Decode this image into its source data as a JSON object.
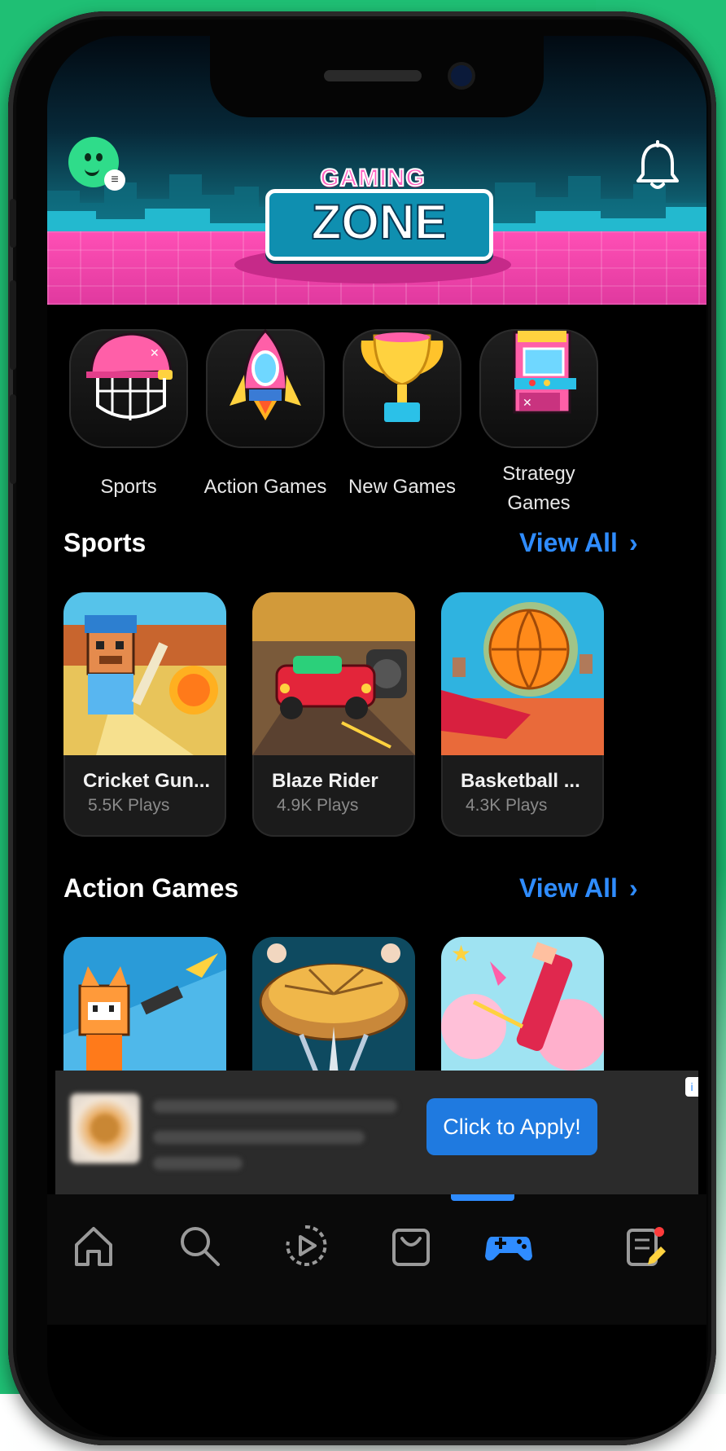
{
  "header": {
    "logo_top": "GAMING",
    "logo_main": "ZONE",
    "avatar_menu_icon": "menu-badge-icon",
    "notification_icon": "bell-icon"
  },
  "categories": [
    {
      "label": "Sports",
      "icon": "cricket-helmet-icon"
    },
    {
      "label": "Action Games",
      "icon": "rocket-icon"
    },
    {
      "label": "New Games",
      "icon": "trophy-icon"
    },
    {
      "label": "Strategy Games",
      "icon": "arcade-machine-icon"
    }
  ],
  "sports": {
    "title": "Sports",
    "view_all": "View All",
    "games": [
      {
        "name": "Cricket Gun...",
        "plays": "5.5K  Plays"
      },
      {
        "name": "Blaze Rider",
        "plays": "4.9K  Plays"
      },
      {
        "name": "Basketball ...",
        "plays": "4.3K  Plays"
      }
    ]
  },
  "action": {
    "title": "Action Games",
    "view_all": "View All"
  },
  "ad": {
    "button": "Click to Apply!"
  },
  "nav": {
    "items": [
      "home-icon",
      "search-icon",
      "history-play-icon",
      "shopping-bag-icon",
      "gamepad-icon",
      "notes-icon"
    ],
    "active_index": 4
  },
  "colors": {
    "accent": "#2f8cff",
    "background": "#000000",
    "brand_pink": "#ff4fb5",
    "page_green": "#1fbf74"
  }
}
